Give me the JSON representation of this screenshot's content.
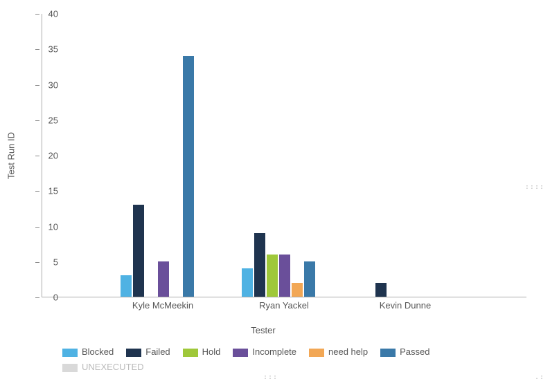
{
  "chart_data": {
    "type": "bar",
    "title": "",
    "xlabel": "Tester",
    "ylabel": "Test Run ID",
    "ylim": [
      0,
      40
    ],
    "yticks": [
      0,
      5,
      10,
      15,
      20,
      25,
      30,
      35,
      40
    ],
    "categories": [
      "Kyle McMeekin",
      "Ryan Yackel",
      "Kevin Dunne"
    ],
    "series": [
      {
        "name": "Blocked",
        "color": "#4fb2e3",
        "values": [
          3,
          4,
          0
        ]
      },
      {
        "name": "Failed",
        "color": "#1f344f",
        "values": [
          13,
          9,
          2
        ]
      },
      {
        "name": "Hold",
        "color": "#9fc83a",
        "values": [
          0,
          6,
          0
        ]
      },
      {
        "name": "Incomplete",
        "color": "#6a4f9a",
        "values": [
          5,
          6,
          0
        ]
      },
      {
        "name": "need help",
        "color": "#f2a755",
        "values": [
          0,
          2,
          0
        ]
      },
      {
        "name": "Passed",
        "color": "#3a79a8",
        "values": [
          34,
          5,
          0
        ]
      },
      {
        "name": "UNEXECUTED",
        "color": "#d9d9d9",
        "values": [
          0,
          0,
          0
        ]
      }
    ]
  },
  "handles": {
    "dots": "::::",
    "mid": ":::",
    "corner": ".:"
  }
}
